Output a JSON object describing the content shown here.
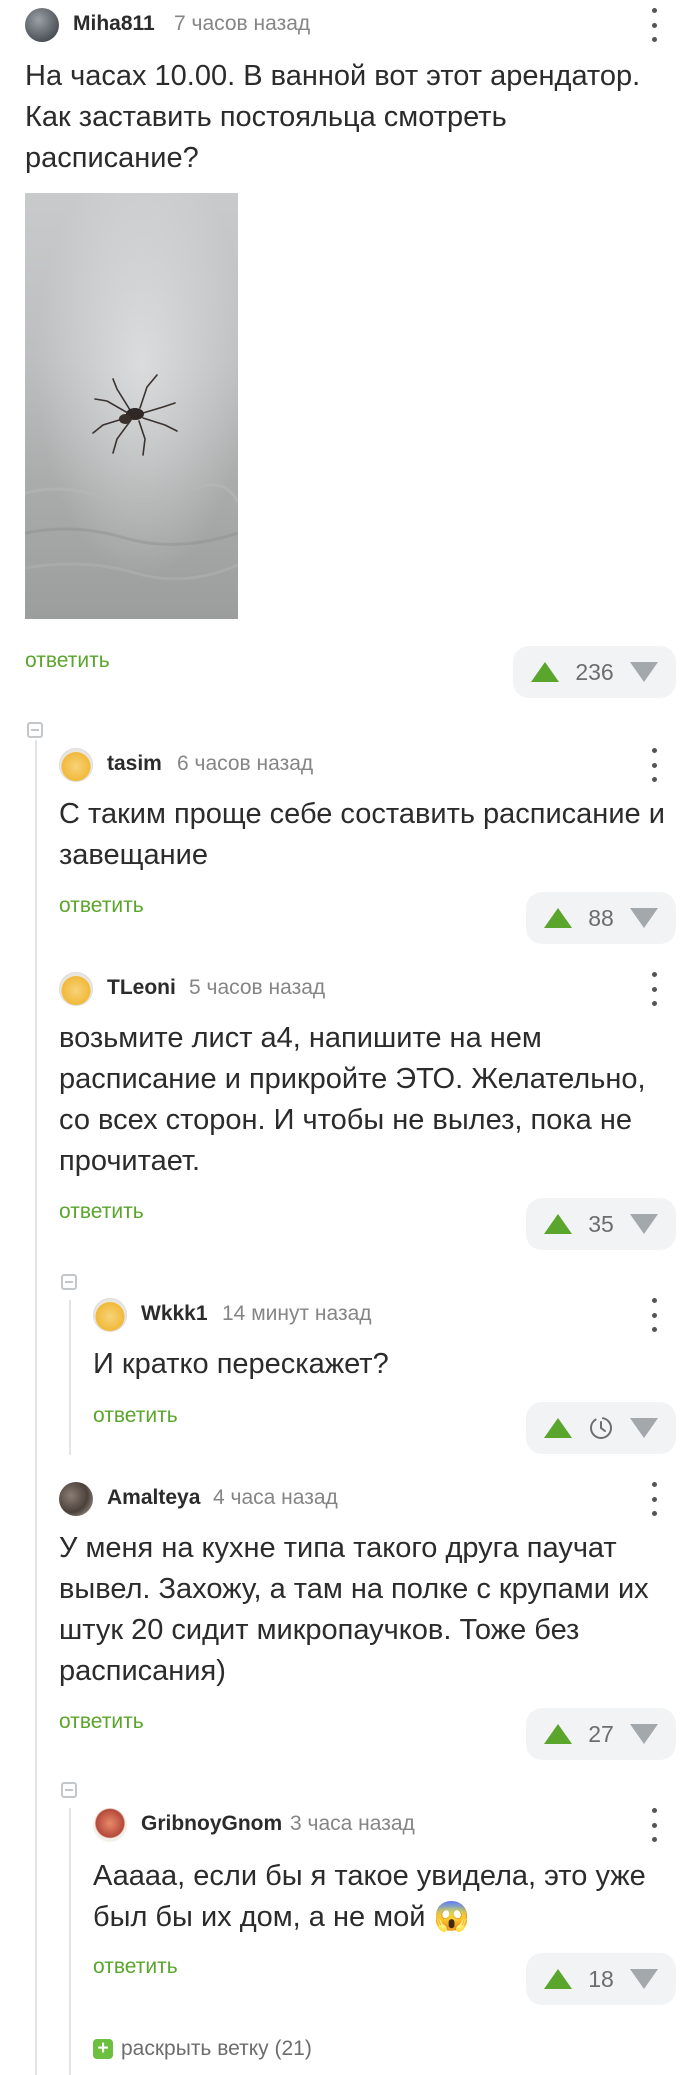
{
  "comments": [
    {
      "author": "Miha811",
      "time": "7 часов назад",
      "text": "На часах 10.00. В ванной вот этот арендатор. Как заставить постояльца смотреть расписание?",
      "reply_label": "ответить",
      "score": "236",
      "image_desc": "spider-photo"
    },
    {
      "author": "tasim",
      "time": "6 часов назад",
      "text": "С таким проще себе составить расписание и завещание",
      "reply_label": "ответить",
      "score": "88"
    },
    {
      "author": "TLeoni",
      "time": "5 часов назад",
      "text": "возьмите лист а4, напишите на нем расписание и прикройте ЭТО. Желательно, со всех сторон. И чтобы не вылез, пока не прочитает.",
      "reply_label": "ответить",
      "score": "35"
    },
    {
      "author": "Wkkk1",
      "time": "14 минут назад",
      "text": "И кратко перескажет?",
      "reply_label": "ответить",
      "score_icon": "clock-pending-icon"
    },
    {
      "author": "Amalteya",
      "time": "4 часа назад",
      "text": "У меня на кухне типа такого друга паучат вывел. Захожу, а там на полке с крупами их штук 20 сидит микропаучков. Тоже без расписания)",
      "reply_label": "ответить",
      "score": "27"
    },
    {
      "author": "GribnoyGnom",
      "time": "3 часа назад",
      "text": "Ааааа, если бы я такое увидела, это уже был бы их дом, а не мой 😱",
      "reply_label": "ответить",
      "score": "18"
    }
  ],
  "expand_branch": {
    "label": "раскрыть ветку (21)",
    "icon": "plus-icon"
  },
  "colors": {
    "accent": "#5aa52c",
    "muted": "#858585",
    "vote_bg": "#f1f3f5"
  }
}
